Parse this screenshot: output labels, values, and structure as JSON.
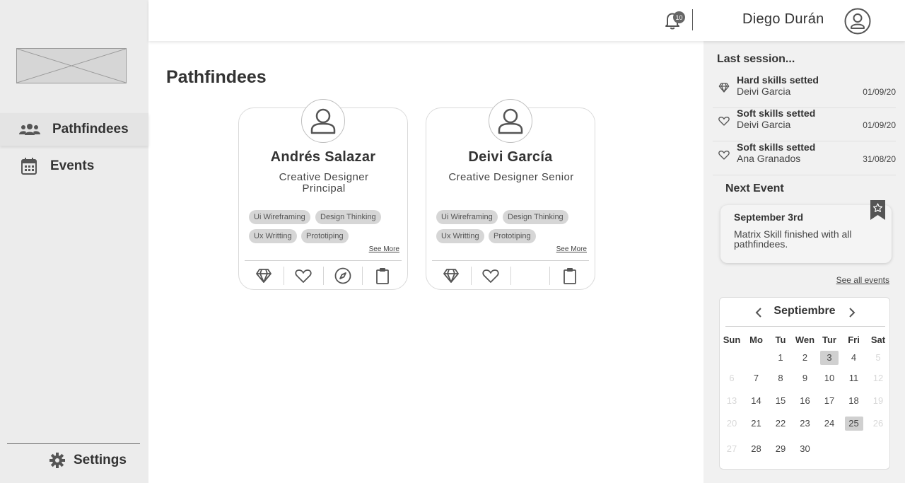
{
  "sidebar": {
    "nav": [
      {
        "label": "Pathfindees",
        "icon": "users-icon",
        "active": true
      },
      {
        "label": "Events",
        "icon": "calendar-icon",
        "active": false
      }
    ],
    "settings_label": "Settings"
  },
  "header": {
    "notification_count": "10",
    "user_name": "Diego Durán"
  },
  "main": {
    "title": "Pathfindees",
    "cards": [
      {
        "name": "Andrés Salazar",
        "role": "Creative Designer Principal",
        "skills": [
          "Ui Wireframing",
          "Design Thinking",
          "Ux Writting",
          "Prototiping"
        ],
        "see_more": "See More",
        "actions": [
          "diamond-icon",
          "heart-icon",
          "compass-icon",
          "clipboard-icon"
        ]
      },
      {
        "name": "Deivi García",
        "role": "Creative Designer Senior",
        "skills": [
          "Ui Wireframing",
          "Design Thinking",
          "Ux Writting",
          "Prototiping"
        ],
        "see_more": "See More",
        "actions": [
          "diamond-icon",
          "heart-icon",
          "clipboard-icon"
        ]
      }
    ]
  },
  "right_panel": {
    "last_session_title": "Last session...",
    "sessions": [
      {
        "title": "Hard skills setted",
        "name": "Deivi Garcia",
        "date": "01/09/20",
        "icon": "diamond-icon"
      },
      {
        "title": "Soft skills setted",
        "name": "Deivi Garcia",
        "date": "01/09/20",
        "icon": "heart-icon"
      },
      {
        "title": "Soft skills setted",
        "name": "Ana Granados",
        "date": "31/08/20",
        "icon": "heart-icon"
      }
    ],
    "next_event_title": "Next Event",
    "event": {
      "date": "September 3rd",
      "description": "Matrix Skill finished with all pathfindees."
    },
    "see_all_events": "See all events",
    "calendar": {
      "month": "Septiembre",
      "days_of_week": [
        "Sun",
        "Mo",
        "Tu",
        "Wen",
        "Tur",
        "Fri",
        "Sat"
      ],
      "weeks": [
        [
          "",
          "",
          "1",
          "2",
          "3",
          "4",
          "5"
        ],
        [
          "6",
          "7",
          "8",
          "9",
          "10",
          "11",
          "12"
        ],
        [
          "13",
          "14",
          "15",
          "16",
          "17",
          "18",
          "19"
        ],
        [
          "20",
          "21",
          "22",
          "23",
          "24",
          "25",
          "26"
        ],
        [
          "27",
          "28",
          "29",
          "30",
          "",
          "",
          ""
        ]
      ],
      "highlighted": [
        "3",
        "25"
      ]
    }
  }
}
